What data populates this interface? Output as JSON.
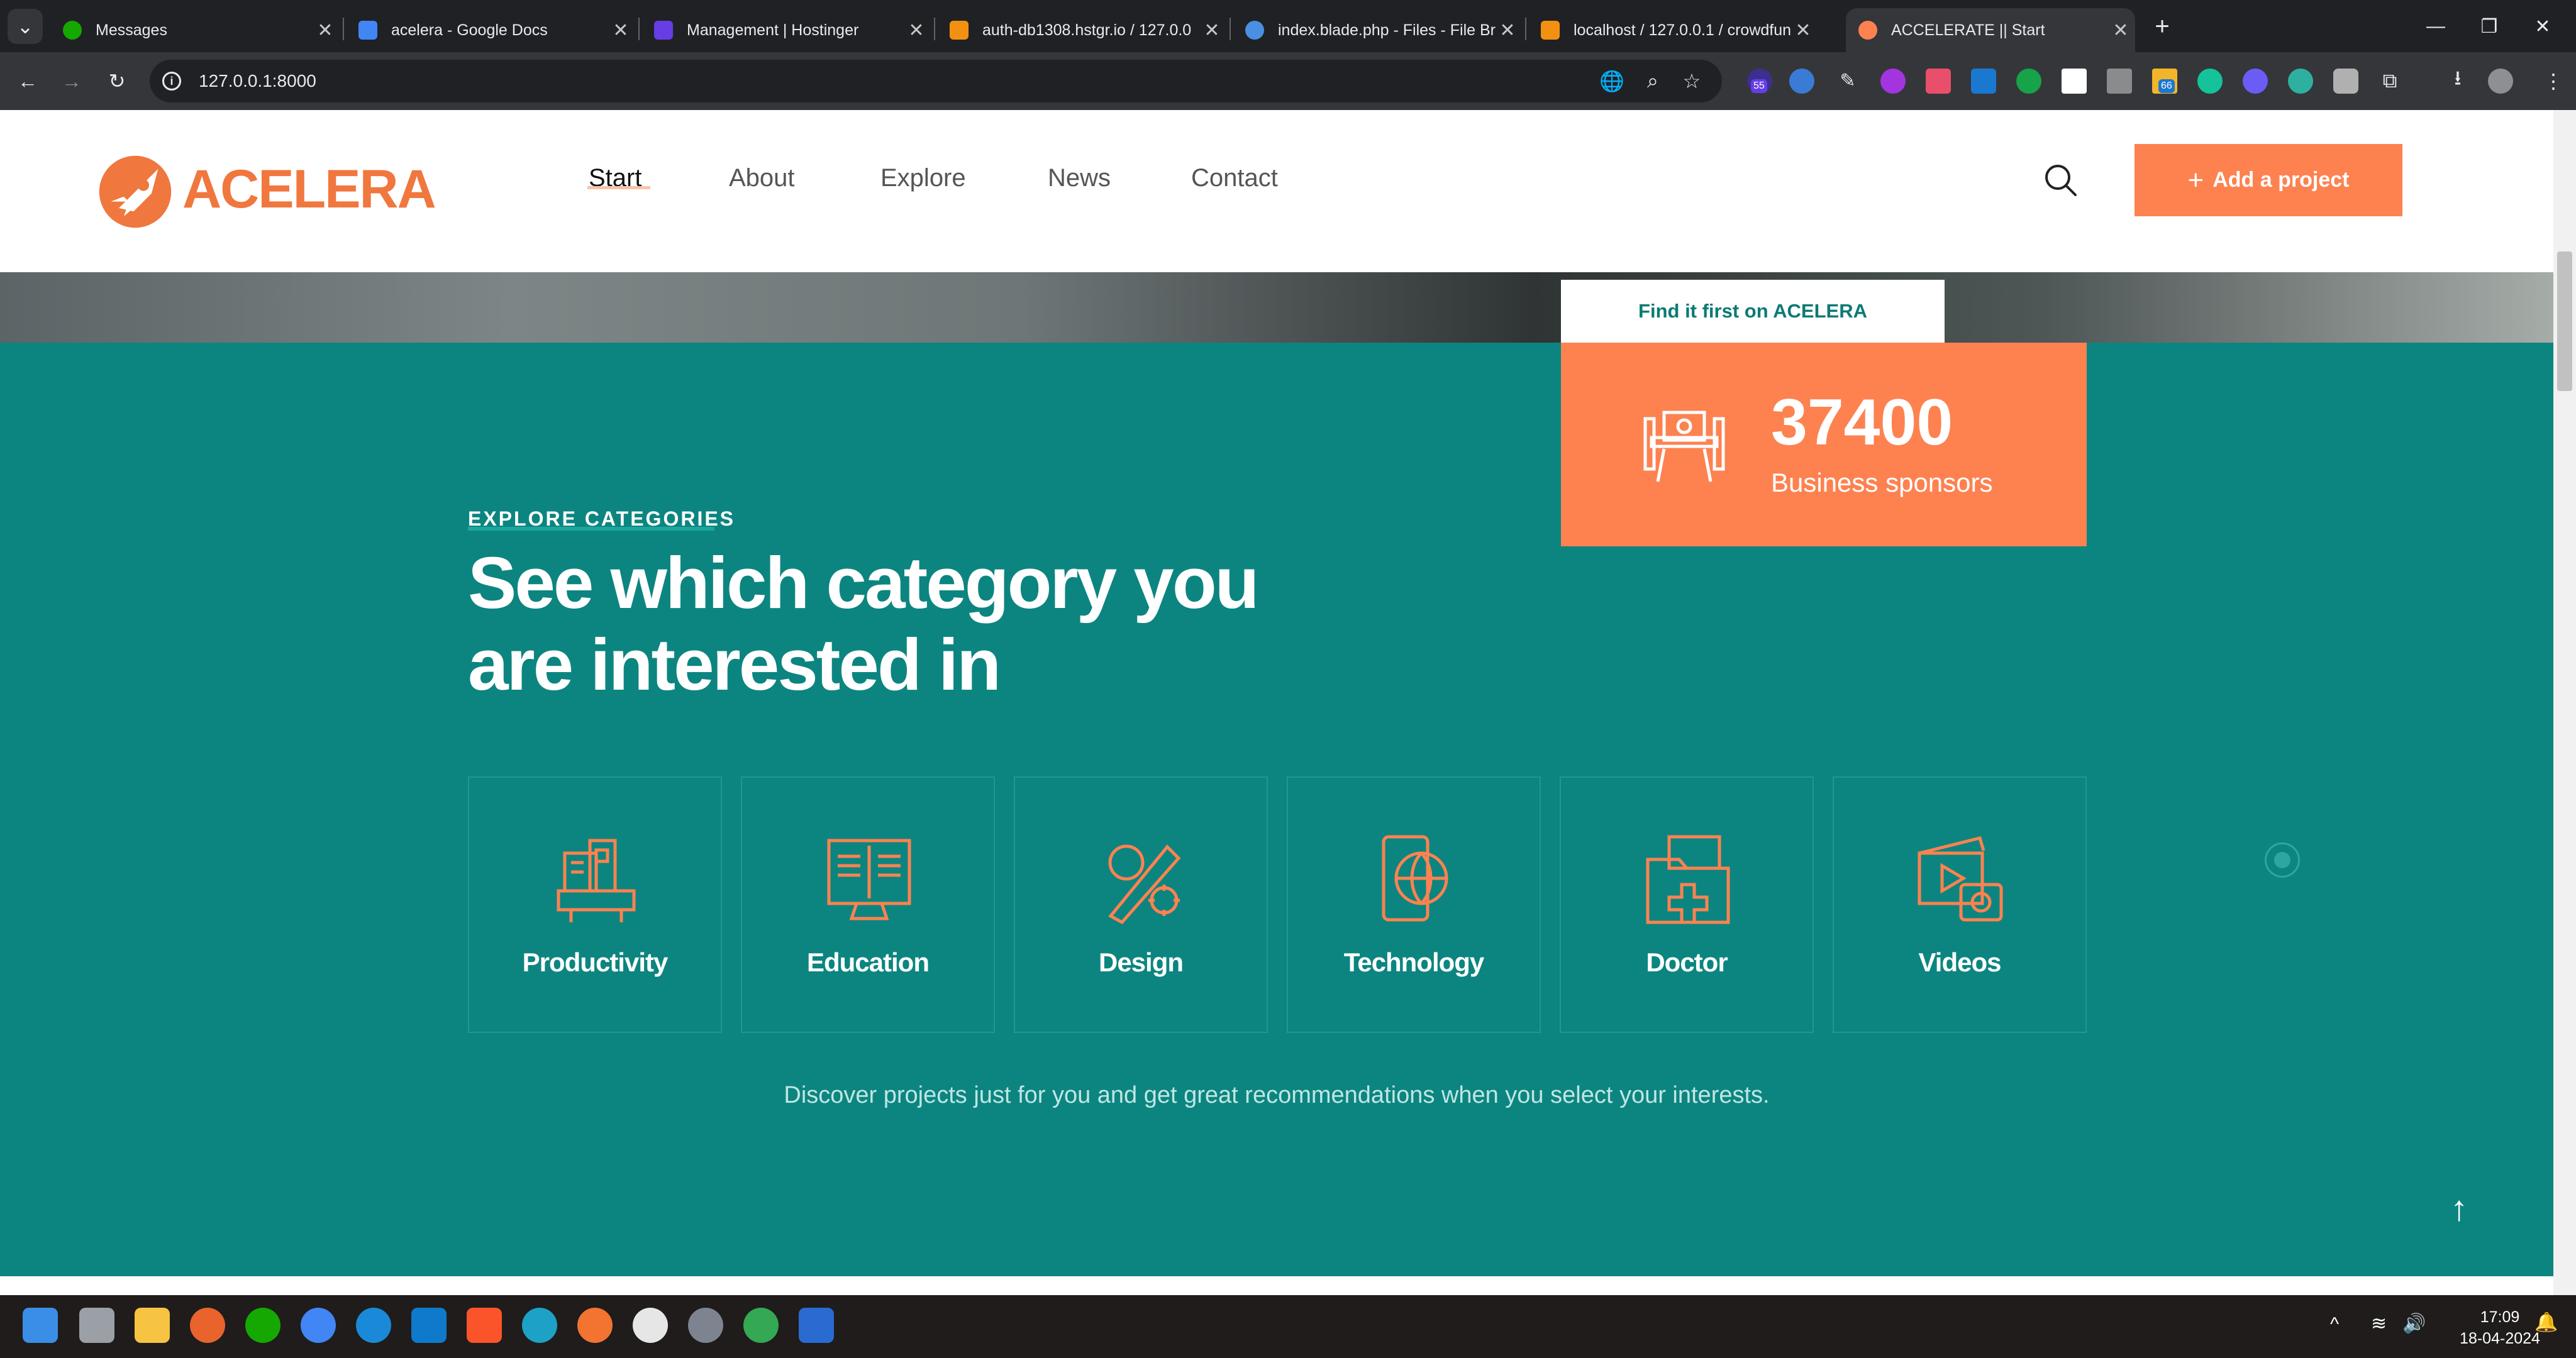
{
  "browser": {
    "tabs": [
      {
        "title": "Messages",
        "favicon": "upwork-icon",
        "color": "#14a800"
      },
      {
        "title": "acelera - Google Docs",
        "favicon": "google-docs-icon",
        "color": "#4285f4"
      },
      {
        "title": "Management | Hostinger",
        "favicon": "hostinger-icon",
        "color": "#673de6"
      },
      {
        "title": "auth-db1308.hstgr.io / 127.0.0",
        "favicon": "phpmyadmin-icon",
        "color": "#f29111"
      },
      {
        "title": "index.blade.php - Files - File Br",
        "favicon": "file-browser-icon",
        "color": "#4a90e2"
      },
      {
        "title": "localhost / 127.0.0.1 / crowdfun",
        "favicon": "phpmyadmin-icon",
        "color": "#f29111"
      },
      {
        "title": "ACCELERATE || Start",
        "favicon": "rocket-icon",
        "color": "#fd8250",
        "active": true
      }
    ],
    "url": "127.0.0.1:8000",
    "badges": {
      "ext1": "55",
      "ext2": "66"
    }
  },
  "site": {
    "logo": "ACELERA",
    "nav": [
      "Start",
      "About",
      "Explore",
      "News",
      "Contact"
    ],
    "add_project": "Add a project"
  },
  "hero": {
    "tag": "Find it first on ACELERA"
  },
  "stat": {
    "number": "37400",
    "label": "Business sponsors"
  },
  "categories_section": {
    "eyebrow": "EXPLORE CATEGORIES",
    "heading_line1": "See which category you",
    "heading_line2": "are interested in",
    "items": [
      "Productivity",
      "Education",
      "Design",
      "Technology",
      "Doctor",
      "Videos"
    ],
    "footer": "Discover projects just for you and get great recommendations when you select your interests."
  },
  "taskbar": {
    "time": "17:09",
    "date": "18-04-2024"
  },
  "colors": {
    "accent": "#fd8250",
    "teal": "#0c8580",
    "white": "#ffffff"
  }
}
